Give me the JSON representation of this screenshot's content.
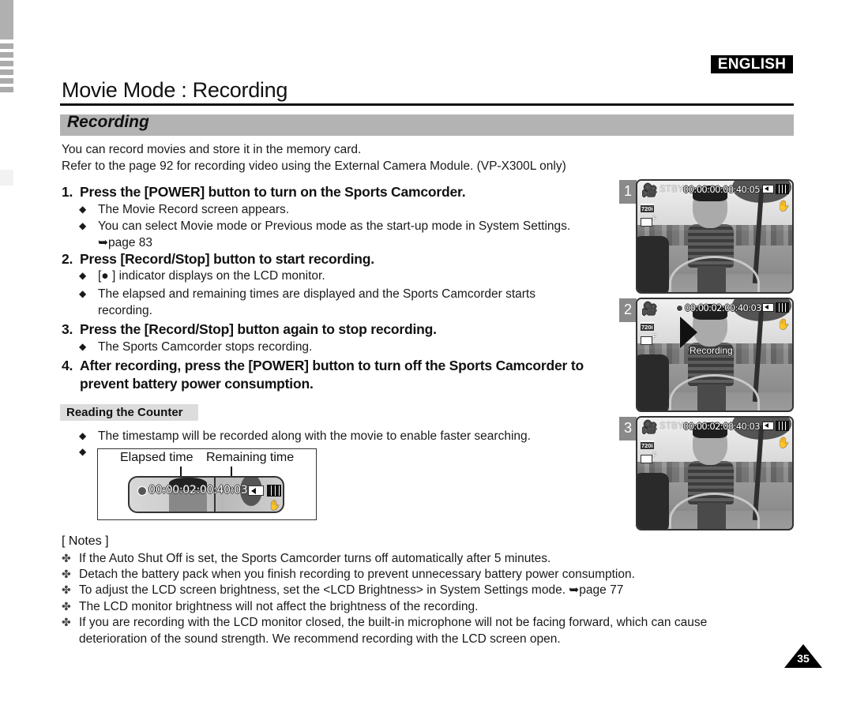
{
  "header": {
    "language_badge": "ENGLISH",
    "page_title": "Movie Mode : Recording",
    "section_title": "Recording"
  },
  "intro": [
    "You can record movies and store it in the memory card.",
    "Refer to the page 92 for recording video using the External Camera Module. (VP-X300L only)"
  ],
  "steps": [
    {
      "num": "1.",
      "title": "Press the [POWER] button to turn on the Sports Camcorder.",
      "bullets": [
        "The Movie Record screen appears.",
        "You can select Movie mode or Previous mode as the start-up mode in System Settings.",
        "➥page 83"
      ]
    },
    {
      "num": "2.",
      "title": "Press [Record/Stop] button to start recording.",
      "bullets": [
        "[● ] indicator displays on the LCD monitor.",
        "The elapsed and remaining times are displayed and the Sports Camcorder starts",
        "recording."
      ]
    },
    {
      "num": "3.",
      "title": "Press the [Record/Stop] button again to stop recording.",
      "bullets": [
        "The Sports Camcorder stops recording."
      ]
    },
    {
      "num": "4.",
      "title_line1": "After recording, press the [POWER] button to turn off the Sports Camcorder to",
      "title_line2": "prevent battery power consumption."
    }
  ],
  "bullet_symbol": "◆",
  "counter": {
    "heading": "Reading the Counter",
    "bullet_text": "The timestamp will be recorded along with the movie to enable faster searching.",
    "elapsed_label": "Elapsed time",
    "remaining_label": "Remaining time",
    "time_display": "00:00:02:00:40:03"
  },
  "notes": {
    "heading": "[ Notes ]",
    "symbol": "✤",
    "items": [
      "If the Auto Shut Off is set, the Sports Camcorder turns off automatically after 5 minutes.",
      "Detach the battery pack when you finish recording to prevent unnecessary battery power consumption.",
      "To adjust the LCD screen brightness, set the <LCD Brightness> in System Settings mode. ➥page 77",
      "The LCD monitor brightness will not affect the brightness of the recording."
    ],
    "last_item_line1": "If you are recording with the LCD monitor closed, the built-in microphone will not be facing forward, which can cause",
    "last_item_line2": "deterioration of the sound strength. We recommend recording with the LCD screen open."
  },
  "screens": [
    {
      "num": "1",
      "mode": "STBY",
      "time": "00:00:00:00:40:05",
      "quality": "720i",
      "overlay": ""
    },
    {
      "num": "2",
      "mode": "",
      "time": "00:00:02:00:40:03",
      "quality": "720i",
      "overlay": "Recording"
    },
    {
      "num": "3",
      "mode": "STBY",
      "time": "00:00:02:00:40:03",
      "quality": "720i",
      "overlay": ""
    }
  ],
  "page_number": "35"
}
